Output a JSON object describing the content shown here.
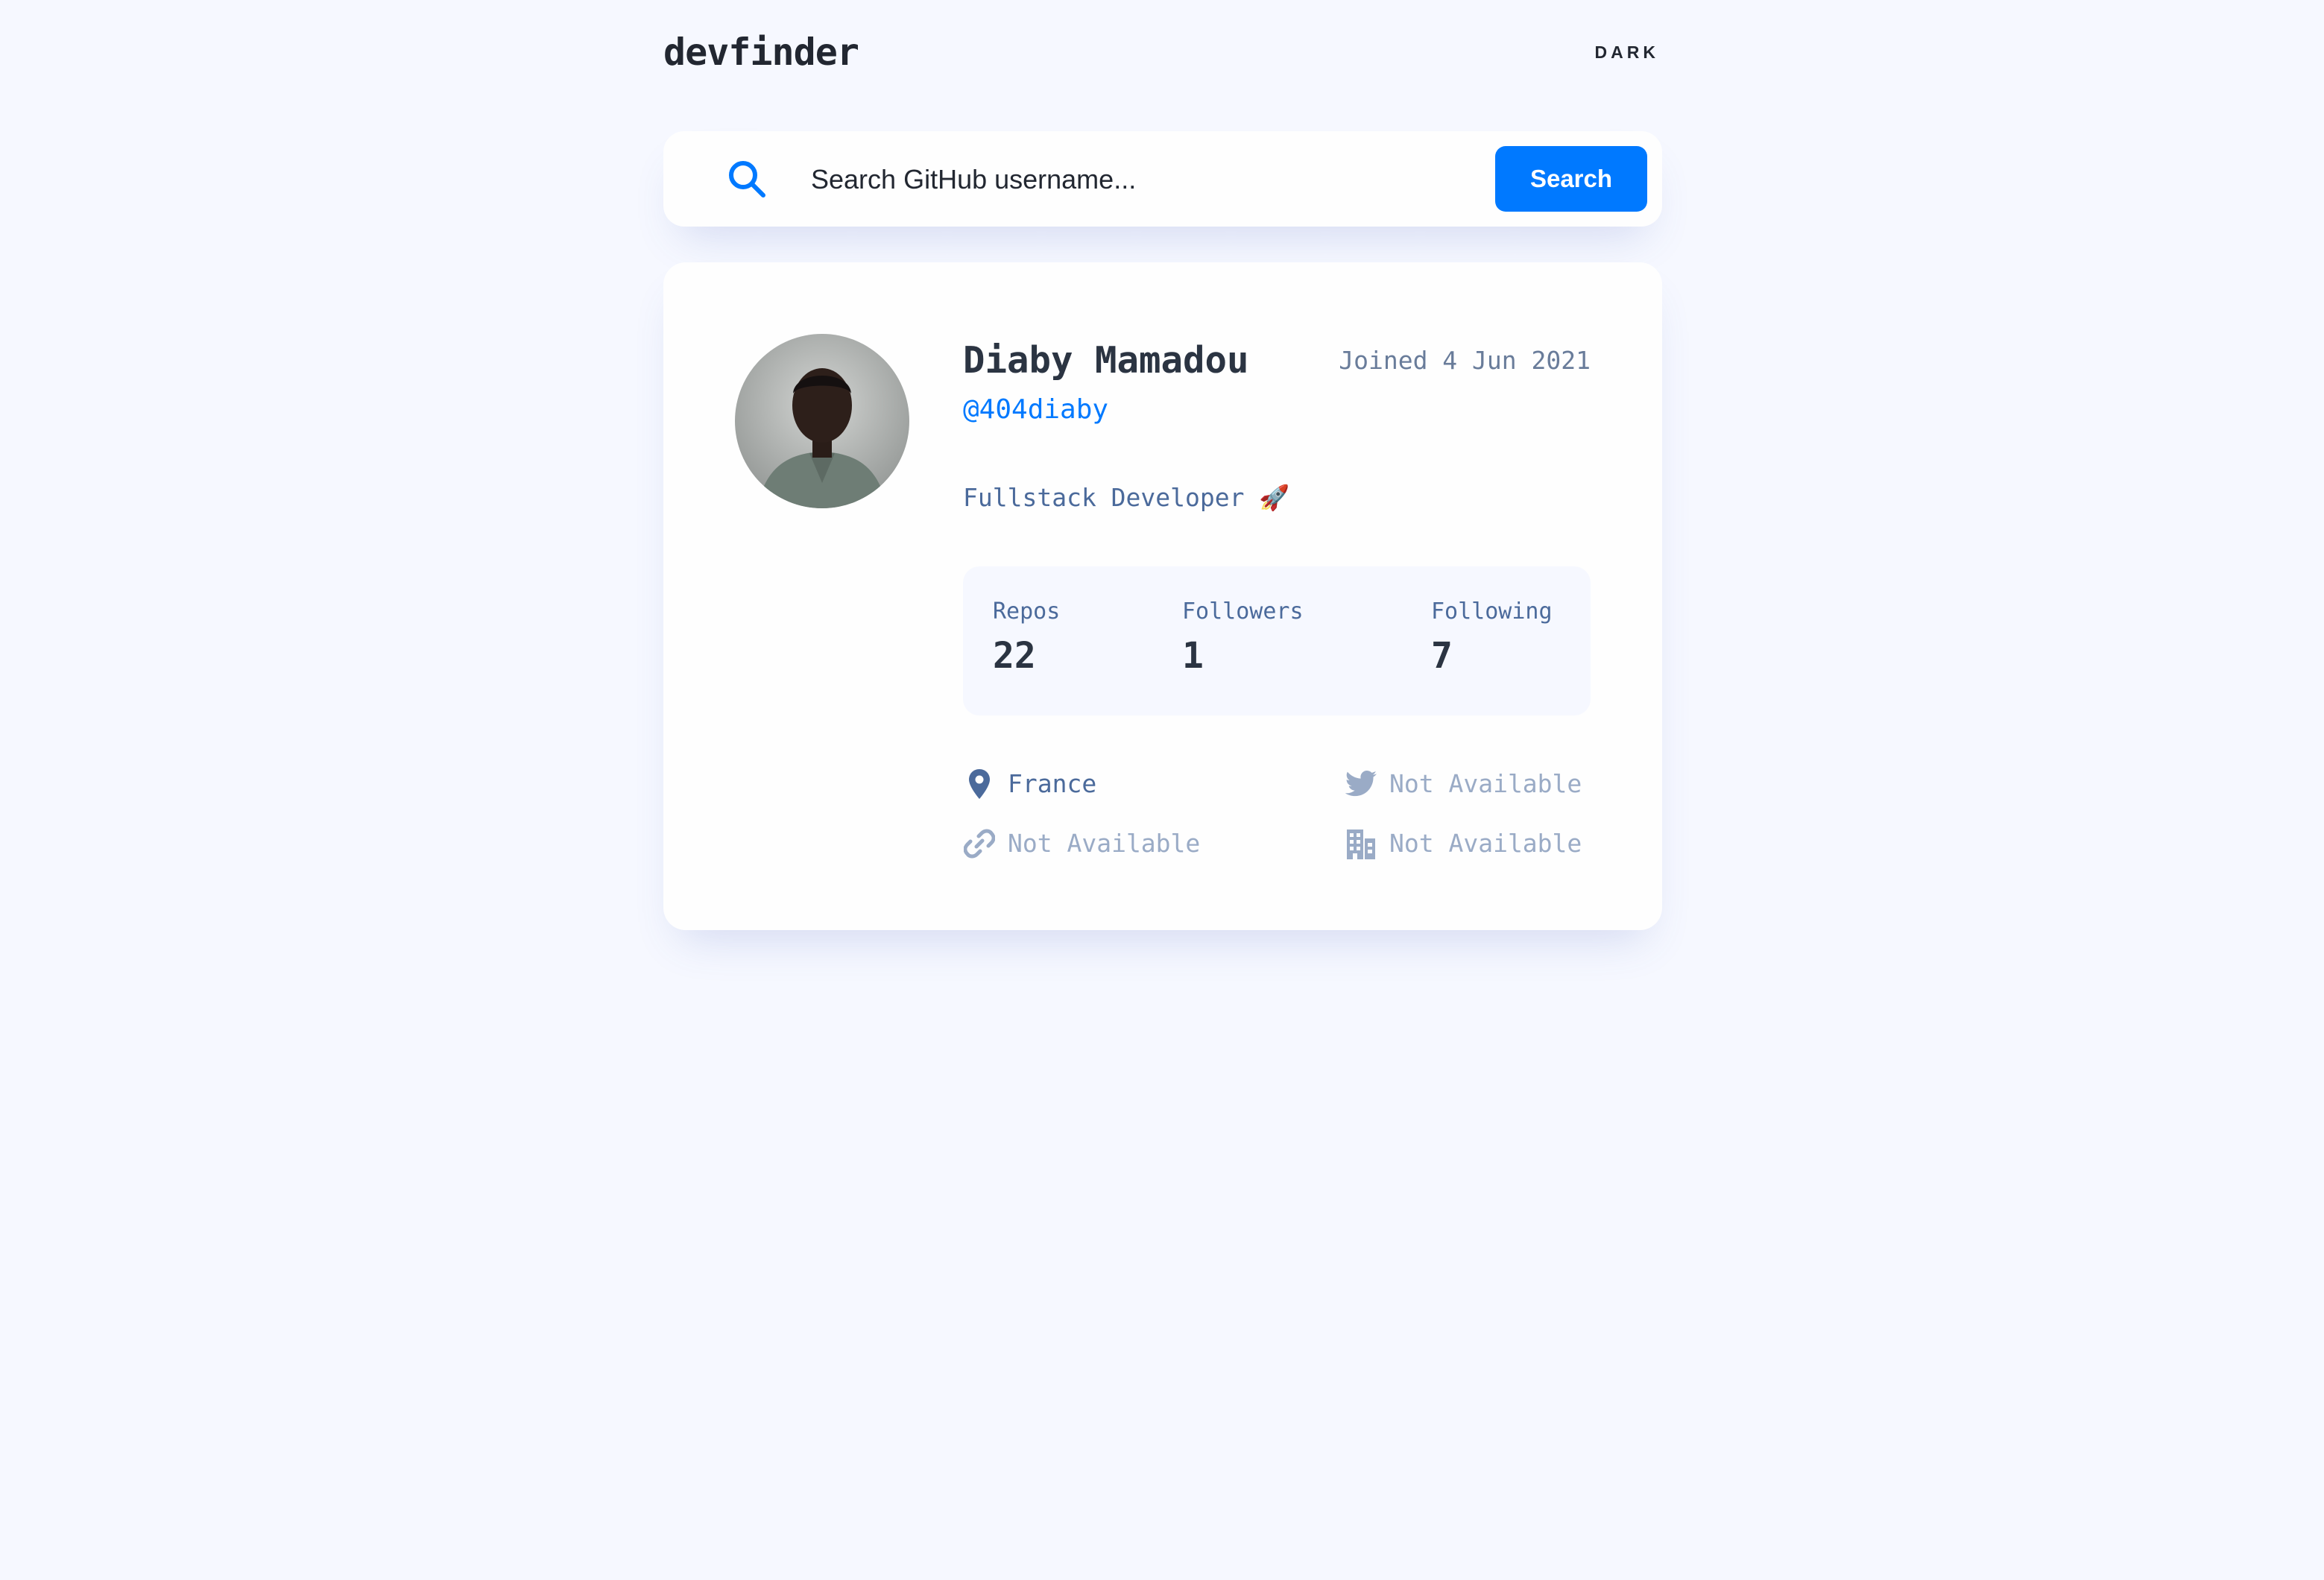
{
  "header": {
    "brand": "devfinder",
    "theme_toggle": "DARK"
  },
  "search": {
    "placeholder": "Search GitHub username...",
    "value": "",
    "button_label": "Search"
  },
  "profile": {
    "name": "Diaby Mamadou",
    "login": "@404diaby",
    "joined": "Joined 4 Jun 2021",
    "bio": "Fullstack Developer 🚀",
    "avatar_alt": "avatar"
  },
  "stats": {
    "repos_label": "Repos",
    "repos": "22",
    "followers_label": "Followers",
    "followers": "1",
    "following_label": "Following",
    "following": "7"
  },
  "links": {
    "location": "France",
    "twitter": "Not Available",
    "blog": "Not Available",
    "company": "Not Available"
  },
  "colors": {
    "accent": "#0079ff",
    "background": "#f6f8ff",
    "card": "#fefefe",
    "muted": "#4b6a9b",
    "unavailable": "#9aabc6"
  }
}
